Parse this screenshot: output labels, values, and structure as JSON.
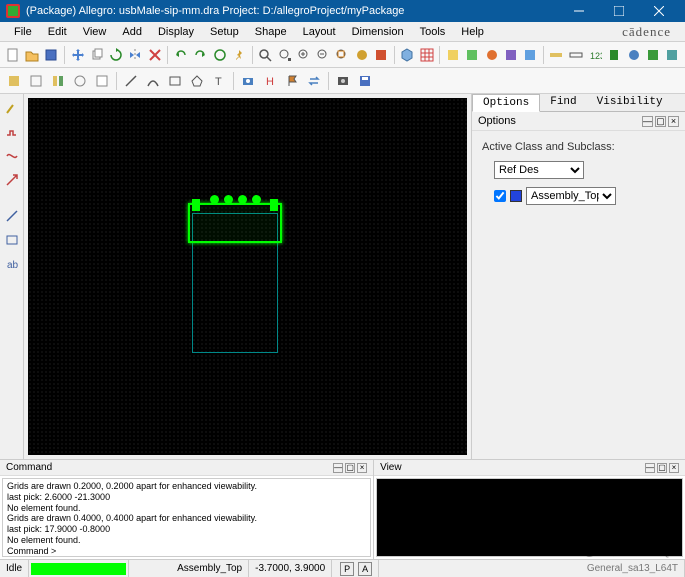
{
  "window": {
    "title": "(Package) Allegro: usbMale-sip-mm.dra  Project: D:/allegroProject/myPackage"
  },
  "menus": [
    "File",
    "Edit",
    "View",
    "Add",
    "Display",
    "Setup",
    "Shape",
    "Layout",
    "Dimension",
    "Tools",
    "Help"
  ],
  "brand": "cādence",
  "right_panel": {
    "tabs": [
      "Options",
      "Find",
      "Visibility"
    ],
    "active_tab": "Options",
    "heading": "Options",
    "group_label": "Active Class and Subclass:",
    "class_select": "Ref Des",
    "subclass_select": "Assembly_Top"
  },
  "command_pane": {
    "title": "Command",
    "log": "Grids are drawn 0.2000, 0.2000 apart for enhanced viewability.\nlast pick:  2.6000 -21.3000\nNo element found.\nGrids are drawn 0.4000, 0.4000 apart for enhanced viewability.\nlast pick:  17.9000 -0.8000\nNo element found.\nCommand >"
  },
  "view_pane": {
    "title": "View"
  },
  "status": {
    "mode": "Idle",
    "layer": "Assembly_Top",
    "coords": "-3.7000, 3.9000",
    "btn_p": "P",
    "btn_a": "A",
    "info": "General_sa13_L64T",
    "watermark": "CSDN @长沙红胖子Qt"
  },
  "toolbar_icons": {
    "new": "new-file",
    "open": "open-file",
    "save": "save",
    "sep": "",
    "move": "move",
    "copy": "copy",
    "rotate": "rotate",
    "mirror": "mirror",
    "delete": "delete",
    "undo": "undo",
    "redo": "redo",
    "refresh": "refresh",
    "pin": "pin",
    "search": "search",
    "zoom-fit": "zoom-fit",
    "zoom-in": "zoom-in",
    "zoom-out": "zoom-out",
    "zoom-window": "zoom-window",
    "pan": "pan",
    "layers": "layers",
    "cube": "3d-view",
    "grid": "grid",
    "cm": "constraints",
    "net": "nets",
    "shapes": "shapes",
    "drc": "drc",
    "tool": "tool",
    "meas": "measure",
    "ruler": "ruler",
    "via": "via",
    "pad": "pad",
    "stack": "stackup",
    "rep": "report",
    "sel": "select",
    "r2_snap": "snap",
    "r2_grid": "grid2",
    "r2_align": "align",
    "r2_space": "space",
    "r2_prop": "prop",
    "r2_line": "line",
    "r2_arc": "arc",
    "r2_rect": "rect",
    "r2_poly": "poly",
    "r2_text": "text",
    "r2_cam": "camera",
    "r2_h": "h",
    "r2_flag": "flag",
    "r2_swap": "swap",
    "r2_photo": "photo",
    "r2_disk": "disk"
  }
}
